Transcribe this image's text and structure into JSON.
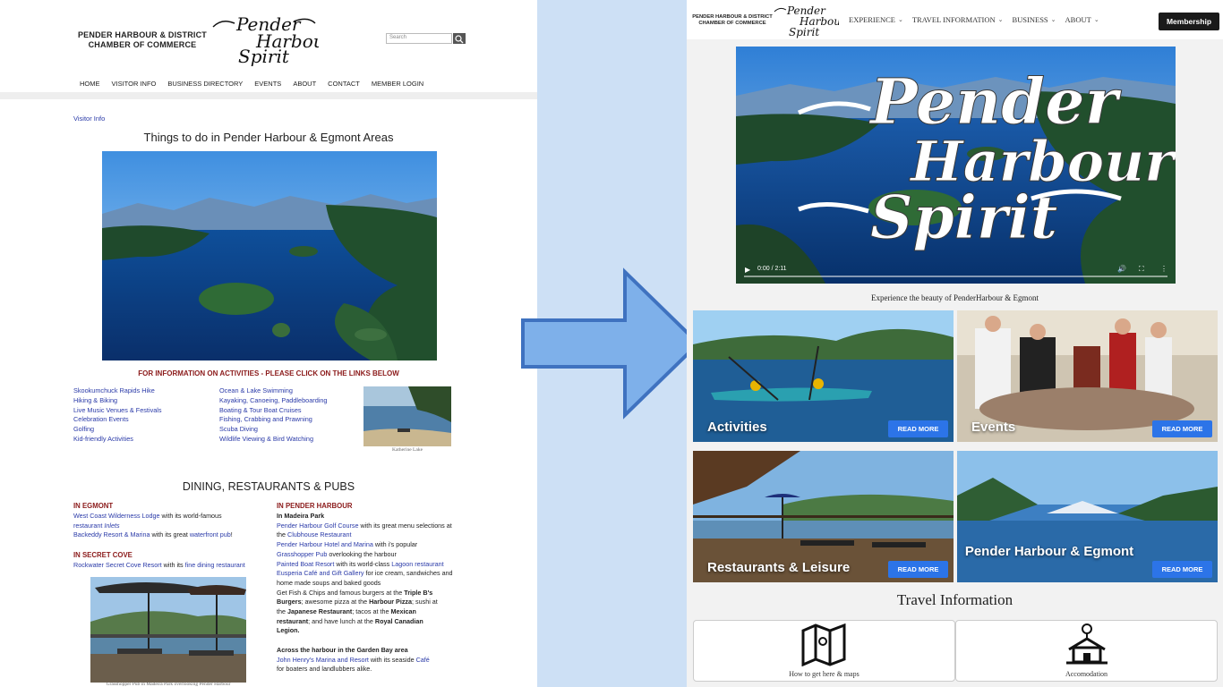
{
  "old_site": {
    "chamber_name": "PENDER HARBOUR & DISTRICT CHAMBER OF COMMERCE",
    "logo_text": [
      "Pender",
      "Harbour",
      "Spirit"
    ],
    "search_placeholder": "Search",
    "nav": [
      "HOME",
      "VISITOR INFO",
      "BUSINESS DIRECTORY",
      "EVENTS",
      "ABOUT",
      "CONTACT",
      "MEMBER LOGIN"
    ],
    "breadcrumb": "Visitor Info",
    "page_title": "Things to do in Pender Harbour & Egmont Areas",
    "info_heading": "FOR INFORMATION ON ACTIVITIES  - PLEASE CLICK ON THE LINKS BELOW",
    "activities_col1": [
      "Skookumchuck Rapids Hike",
      "Hiking & Biking",
      "Live Music Venues & Festivals",
      "Celebration Events",
      "Golfing",
      "Kid-friendly Activities"
    ],
    "activities_col2": [
      "Ocean & Lake Swimming",
      "Kayaking, Canoeing, Paddleboarding",
      "Boating & Tour Boat Cruises",
      "Fishing, Crabbing and Prawning",
      "Scuba Diving",
      "Wildlife Viewing & Bird Watching"
    ],
    "lake_caption": "Katherine Lake",
    "dining_title": "DINING, RESTAURANTS & PUBS",
    "egmont": {
      "heading": "IN EGMONT",
      "l1_link": "West Coast Wilderness Lodge",
      "l1_text": " with its world-famous",
      "l2_link": "restaurant",
      "l2_em": "Inlets",
      "l3_link": "Backeddy Resort & Marina",
      "l3_text": " with its great ",
      "l3_link2": "waterfront pub",
      "l3_end": "!"
    },
    "secret_cove": {
      "heading": "IN SECRET COVE",
      "link": "Rockwater Secret Cove Resort",
      "text": " with its ",
      "link2": "fine dining restaurant"
    },
    "pender": {
      "heading": "IN PENDER HARBOUR",
      "sub": "In Madeira Park",
      "lines": [
        {
          "a": "Pender Harbour Golf Course",
          "b": " with its great menu selections at"
        },
        {
          "pre": "the ",
          "a": "Clubhouse Restaurant"
        },
        {
          "a": "Pender Harbour Hotel and Marina",
          "b": " with i's popular"
        },
        {
          "a": "Grasshopper Pub",
          "b": " overlooking the harbour"
        },
        {
          "a": "Painted Boat Resort",
          "b": " with its world-class ",
          "c": "Lagoon restaurant"
        },
        {
          "a": "Eusperia Café and Gift Gallery",
          "b": " for ice cream, sandwiches and"
        }
      ],
      "plain_line": "home made soups and baked goods",
      "fish_line1": "Get Fish & Chips and famous burgers at the ",
      "fish_bold1": "Triple B's",
      "fish_line2_bold": "Burgers",
      "fish_line2": "; awesome pizza at the ",
      "fish_line2_bold2": "Harbour Pizza",
      "fish_line2_end": "; sushi at",
      "fish_line3_pre": "the ",
      "fish_line3_bold": "Japanese Restaurant",
      "fish_line3": "; tacos at the ",
      "fish_line3_bold2": "Mexican",
      "fish_line4_bold": "restaurant",
      "fish_line4": "; and have lunch at the ",
      "fish_line4_bold2": "Royal Canadian",
      "fish_line5_bold": "Legion.",
      "garden_bay_heading": "Across the harbour in the Garden Bay area",
      "garden_link": "John Henry's Marina and Resort",
      "garden_text": " with its seaside ",
      "garden_link2": "Café",
      "garden_end": "for boaters and landlubbers alike."
    },
    "pub_caption": "Grasshopper Pub in Madeira Park overlooking Pender Harbour"
  },
  "new_site": {
    "chamber_name": "PENDER HARBOUR & DISTRICT CHAMBER OF COMMERCE",
    "logo_text": [
      "Pender",
      "Harbour",
      "Spirit"
    ],
    "menu": [
      "EXPERIENCE",
      "TRAVEL INFORMATION",
      "BUSINESS",
      "ABOUT"
    ],
    "membership_button": "Membership",
    "video_title": [
      "Pender",
      "Harbour",
      "Spirit"
    ],
    "video_time": "0:00 / 2:11",
    "tagline": "Experience the beauty of PenderHarbour & Egmont",
    "cards": [
      {
        "label": "Activities",
        "button": "READ MORE"
      },
      {
        "label": "Events",
        "button": "READ MORE"
      },
      {
        "label": "Restaurants & Leisure",
        "button": "READ MORE"
      },
      {
        "label": "Pender Harbour & Egmont",
        "button": "READ MORE"
      }
    ],
    "travel_heading": "Travel Information",
    "travel_cards": [
      {
        "label": "How to get here & maps"
      },
      {
        "label": "Accomodation"
      }
    ]
  },
  "colors": {
    "middle_bg": "#cde0f5",
    "arrow_fill": "#7eb0ea",
    "arrow_stroke": "#3f72c0",
    "link_blue": "#2a3aa8",
    "heading_red": "#8b1a1a",
    "read_more_blue": "#2c74e8"
  }
}
